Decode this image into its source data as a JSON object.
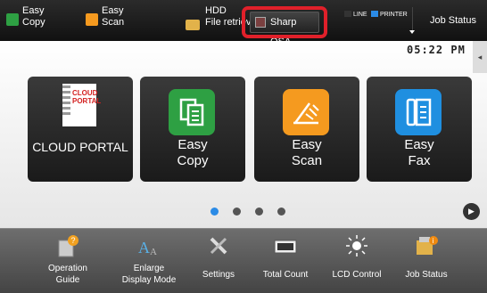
{
  "topbar": {
    "easy_copy": "Easy\nCopy",
    "easy_scan": "Easy\nScan",
    "hdd": "HDD\nFile retriev",
    "sharp_osa": "Sharp OSA",
    "line": "LINE",
    "printer": "PRINTER",
    "job_status": "Job Status"
  },
  "clock": "05:22 PM",
  "tiles": [
    {
      "label": "CLOUD PORTAL",
      "icon": "cloud-portal-icon"
    },
    {
      "label": "Easy\nCopy",
      "icon": "copy-icon",
      "color": "#2ea043"
    },
    {
      "label": "Easy\nScan",
      "icon": "scan-icon",
      "color": "#f59a1f"
    },
    {
      "label": "Easy\nFax",
      "icon": "fax-icon",
      "color": "#1f8fe0"
    }
  ],
  "cloud_icon_text": "CLOUD\nPORTAL",
  "dock": [
    {
      "label": "Operation\nGuide"
    },
    {
      "label": "Enlarge\nDisplay Mode"
    },
    {
      "label": "Settings"
    },
    {
      "label": "Total Count"
    },
    {
      "label": "LCD Control"
    },
    {
      "label": "Job Status"
    }
  ],
  "colors": {
    "highlight": "#e0202a",
    "active_dot": "#2b8be6"
  }
}
